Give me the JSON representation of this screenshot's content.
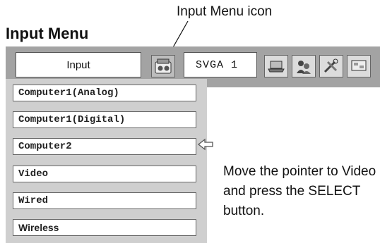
{
  "annotation": {
    "label": "Input Menu icon"
  },
  "page": {
    "title": "Input Menu"
  },
  "toolbar": {
    "input_label": "Input",
    "source_label": "SVGA 1",
    "icons": [
      "input-menu-icon",
      "laptop-icon",
      "people-icon",
      "tools-icon",
      "screen-icon"
    ]
  },
  "menu": {
    "items": [
      {
        "label": "Computer1(Analog)"
      },
      {
        "label": "Computer1(Digital)"
      },
      {
        "label": "Computer2"
      },
      {
        "label": "Video"
      },
      {
        "label": "Wired"
      },
      {
        "label": "Wireless"
      }
    ],
    "pointer_item": "Computer2"
  },
  "instruction": {
    "text": "Move the pointer to Video and press the SELECT button."
  },
  "colors": {
    "toolbar_bg": "#a3a3a3",
    "panel_bg": "#cfcfcf"
  }
}
